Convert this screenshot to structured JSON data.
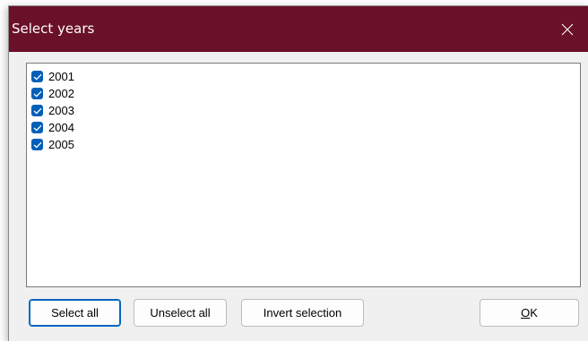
{
  "window": {
    "title": "Select years",
    "close_icon": "close-icon",
    "title_bar_color": "#6a1029"
  },
  "list": {
    "items": [
      {
        "label": "2001",
        "checked": true
      },
      {
        "label": "2002",
        "checked": true
      },
      {
        "label": "2003",
        "checked": true
      },
      {
        "label": "2004",
        "checked": true
      },
      {
        "label": "2005",
        "checked": true
      }
    ],
    "checkbox_color": "#005fb8"
  },
  "buttons": {
    "select_all": "Select all",
    "unselect_all": "Unselect all",
    "invert_selection": "Invert selection",
    "ok_mnemonic": "O",
    "ok_rest": "K"
  }
}
